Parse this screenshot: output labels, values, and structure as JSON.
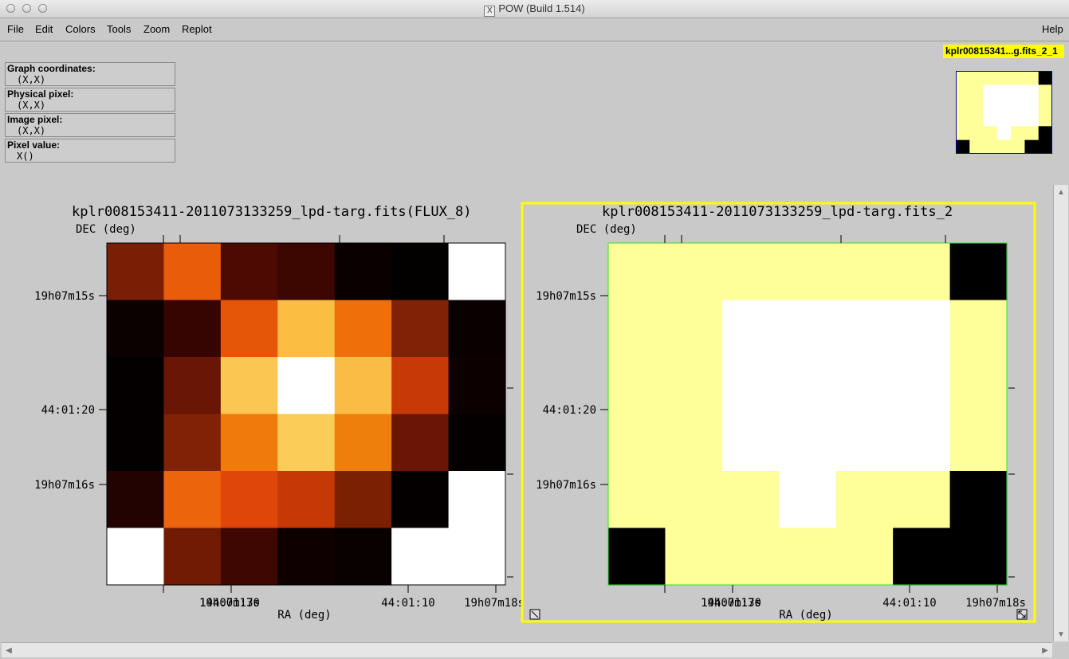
{
  "window": {
    "title": "POW (Build 1.514)",
    "x_glyph": "X"
  },
  "menubar": {
    "file": "File",
    "edit": "Edit",
    "colors": "Colors",
    "tools": "Tools",
    "zoom": "Zoom",
    "replot": "Replot",
    "help": "Help"
  },
  "coords": [
    {
      "label": "Graph coordinates:",
      "value": "(X,X)"
    },
    {
      "label": "Physical pixel:",
      "value": "(X,X)"
    },
    {
      "label": "Image pixel:",
      "value": "(X,X)"
    },
    {
      "label": "Pixel value:",
      "value": "X()"
    }
  ],
  "current_graph_tag": "kplr00815341...g.fits_2_1",
  "colors": {
    "highlight": "#ffff00",
    "green_border": "#33dd33",
    "bg": "#c9c9c9"
  },
  "graphs": [
    {
      "title": "kplr008153411-2011073133259_lpd-targ.fits(FLUX_8)",
      "ylabel": "DEC (deg)",
      "xlabel": "RA (deg)",
      "yticks": [
        "19h07m15s",
        "44:01:20",
        "19h07m16s"
      ],
      "xticks": [
        "144:01:30",
        "19h07m17s",
        "44:01:10",
        "19h07m18s"
      ],
      "colormap": "hot",
      "pixels": [
        [
          "#7a1e06",
          "#e85c0a",
          "#4c0a02",
          "#3c0601",
          "#0a0000",
          "#030000",
          "#ffffff"
        ],
        [
          "#0c0101",
          "#370501",
          "#e55608",
          "#f9be42",
          "#ef6f0a",
          "#7f2205",
          "#0b0000"
        ],
        [
          "#040000",
          "#6a1604",
          "#fbc651",
          "#ffffff",
          "#f9bc44",
          "#c83a05",
          "#0c0000"
        ],
        [
          "#040000",
          "#7f2205",
          "#f07b0c",
          "#fccc59",
          "#ee7f0c",
          "#6b1604",
          "#050000"
        ],
        [
          "#230202",
          "#ec640b",
          "#df470a",
          "#c63905",
          "#7c2004",
          "#050000",
          "#ffffff"
        ],
        [
          "#ffffff",
          "#711a04",
          "#3e0702",
          "#0e0000",
          "#080000",
          "#ffffff",
          "#ffffff"
        ]
      ]
    },
    {
      "title": "kplr008153411-2011073133259_lpd-targ.fits_2",
      "ylabel": "DEC (deg)",
      "xlabel": "RA (deg)",
      "yticks": [
        "19h07m15s",
        "44:01:20",
        "19h07m16s"
      ],
      "xticks": [
        "144:01:30",
        "19h07m17s",
        "44:01:10",
        "19h07m18s"
      ],
      "colormap": "mask",
      "pixels": [
        [
          "#ffff99",
          "#ffff99",
          "#ffff99",
          "#ffff99",
          "#ffff99",
          "#ffff99",
          "#000000"
        ],
        [
          "#ffff99",
          "#ffff99",
          "#ffffff",
          "#ffffff",
          "#ffffff",
          "#ffffff",
          "#ffff99"
        ],
        [
          "#ffff99",
          "#ffff99",
          "#ffffff",
          "#ffffff",
          "#ffffff",
          "#ffffff",
          "#ffff99"
        ],
        [
          "#ffff99",
          "#ffff99",
          "#ffffff",
          "#ffffff",
          "#ffffff",
          "#ffffff",
          "#ffff99"
        ],
        [
          "#ffff99",
          "#ffff99",
          "#ffff99",
          "#ffffff",
          "#ffff99",
          "#ffff99",
          "#000000"
        ],
        [
          "#000000",
          "#ffff99",
          "#ffff99",
          "#ffff99",
          "#ffff99",
          "#000000",
          "#000000"
        ]
      ]
    }
  ],
  "thumbnail": {
    "pixels": [
      [
        "#ffff99",
        "#ffff99",
        "#ffff99",
        "#ffff99",
        "#ffff99",
        "#ffff99",
        "#000000"
      ],
      [
        "#ffff99",
        "#ffff99",
        "#ffffff",
        "#ffffff",
        "#ffffff",
        "#ffffff",
        "#ffff99"
      ],
      [
        "#ffff99",
        "#ffff99",
        "#ffffff",
        "#ffffff",
        "#ffffff",
        "#ffffff",
        "#ffff99"
      ],
      [
        "#ffff99",
        "#ffff99",
        "#ffffff",
        "#ffffff",
        "#ffffff",
        "#ffffff",
        "#ffff99"
      ],
      [
        "#ffff99",
        "#ffff99",
        "#ffff99",
        "#ffffff",
        "#ffff99",
        "#ffff99",
        "#000000"
      ],
      [
        "#000000",
        "#ffff99",
        "#ffff99",
        "#ffff99",
        "#ffff99",
        "#000000",
        "#000000"
      ]
    ]
  }
}
